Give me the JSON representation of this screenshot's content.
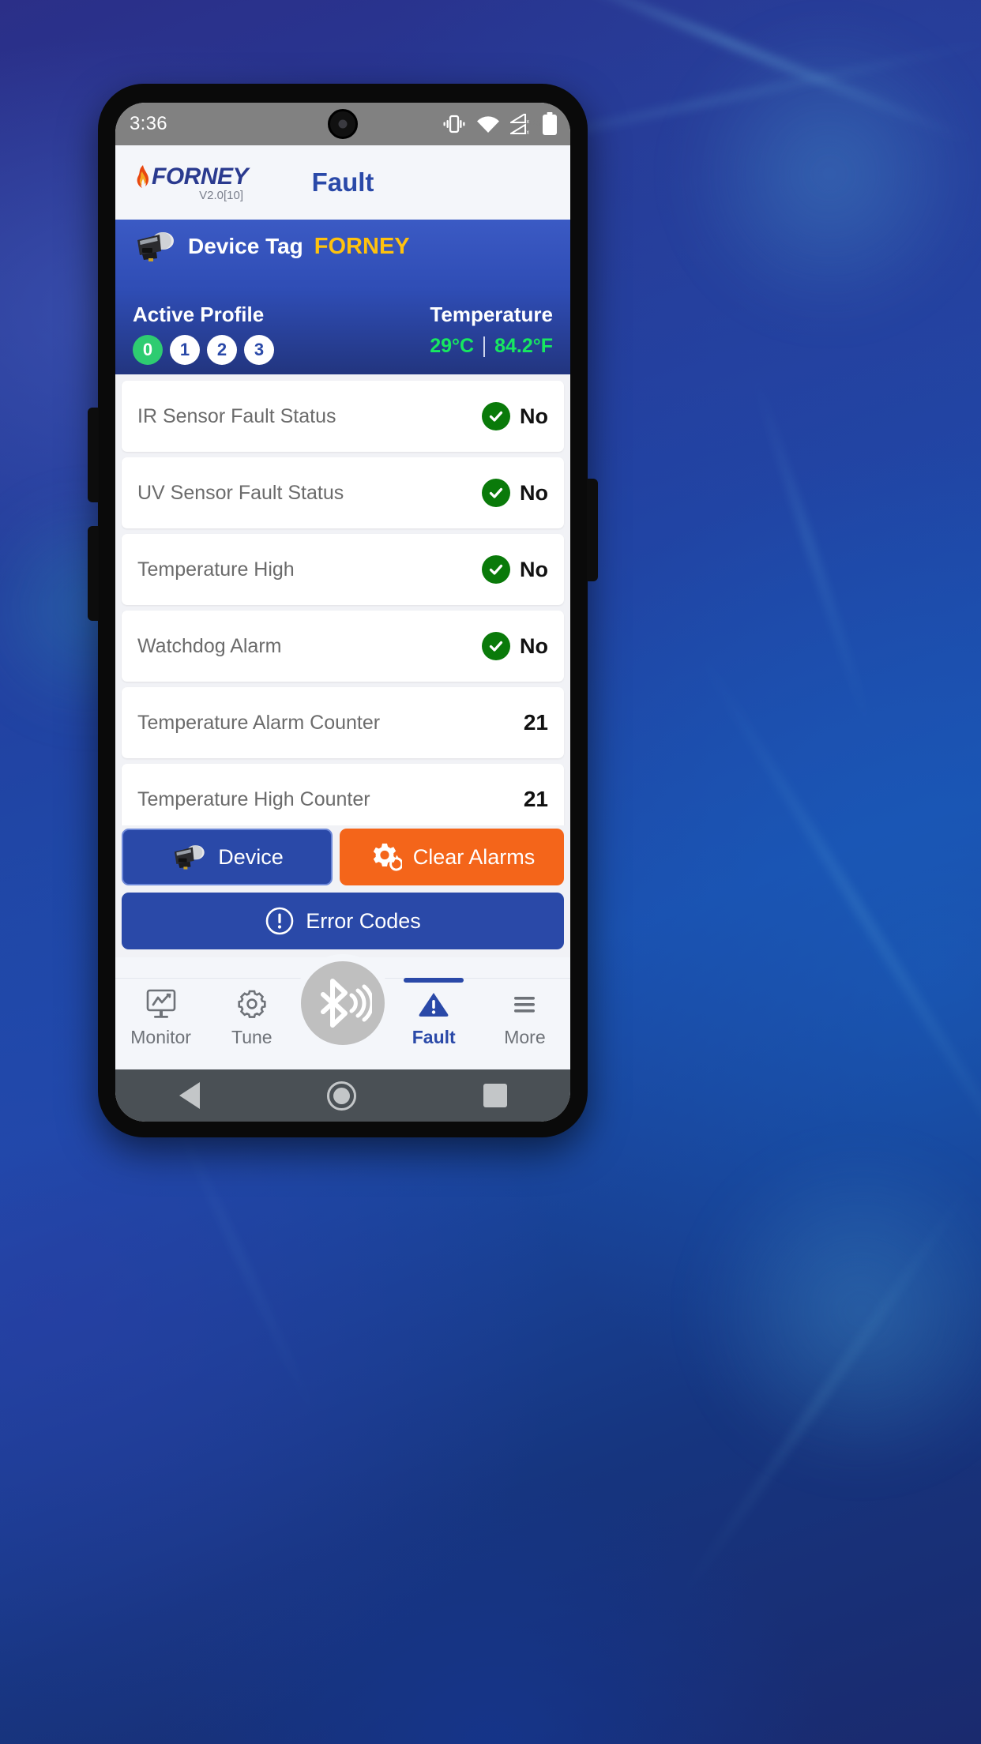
{
  "status_bar": {
    "time": "3:36",
    "battery_level": "100",
    "icons": [
      "vibrate-icon",
      "wifi-icon",
      "signal-no-service-icon",
      "battery-icon"
    ]
  },
  "app_bar": {
    "brand": "FORNEY",
    "version": "V2.0[10]",
    "title": "Fault"
  },
  "device_panel": {
    "device_icon": "flame-scanner-icon",
    "tag_label": "Device Tag",
    "tag_value": "FORNEY",
    "profile_label": "Active Profile",
    "profiles": [
      {
        "label": "0",
        "active": true
      },
      {
        "label": "1",
        "active": false
      },
      {
        "label": "2",
        "active": false
      },
      {
        "label": "3",
        "active": false
      }
    ],
    "temperature_label": "Temperature",
    "temperature_celsius": "29°C",
    "temperature_fahrenheit": "84.2°F",
    "accent_yellow": "#ffc20e",
    "accent_green": "#17e860"
  },
  "fault_rows": [
    {
      "label": "IR Sensor Fault Status",
      "value": "No",
      "type": "status"
    },
    {
      "label": "UV Sensor Fault Status",
      "value": "No",
      "type": "status"
    },
    {
      "label": "Temperature High",
      "value": "No",
      "type": "status"
    },
    {
      "label": "Watchdog Alarm",
      "value": "No",
      "type": "status"
    },
    {
      "label": "Temperature Alarm Counter",
      "value": "21",
      "type": "number"
    },
    {
      "label": "Temperature High Counter",
      "value": "21",
      "type": "number"
    }
  ],
  "actions": {
    "device_label": "Device",
    "device_icon": "flame-scanner-icon",
    "clear_label": "Clear Alarms",
    "clear_icon": "gear-refresh-icon",
    "clear_color": "#f4651a",
    "error_label": "Error Codes",
    "error_icon": "exclamation-circle-icon",
    "primary_color": "#2a49a8"
  },
  "bottom_nav": {
    "fab_icon": "bluetooth-broadcast-icon",
    "items": [
      {
        "label": "Monitor",
        "icon": "monitor-chart-icon",
        "active": false
      },
      {
        "label": "Tune",
        "icon": "gear-icon",
        "active": false
      },
      {
        "label": "Fault",
        "icon": "warning-triangle-icon",
        "active": true
      },
      {
        "label": "More",
        "icon": "hamburger-icon",
        "active": false
      }
    ],
    "active_color": "#2a49a8"
  },
  "android_nav": {
    "back": "back-triangle-icon",
    "home": "home-circle-icon",
    "recent": "recents-square-icon"
  }
}
